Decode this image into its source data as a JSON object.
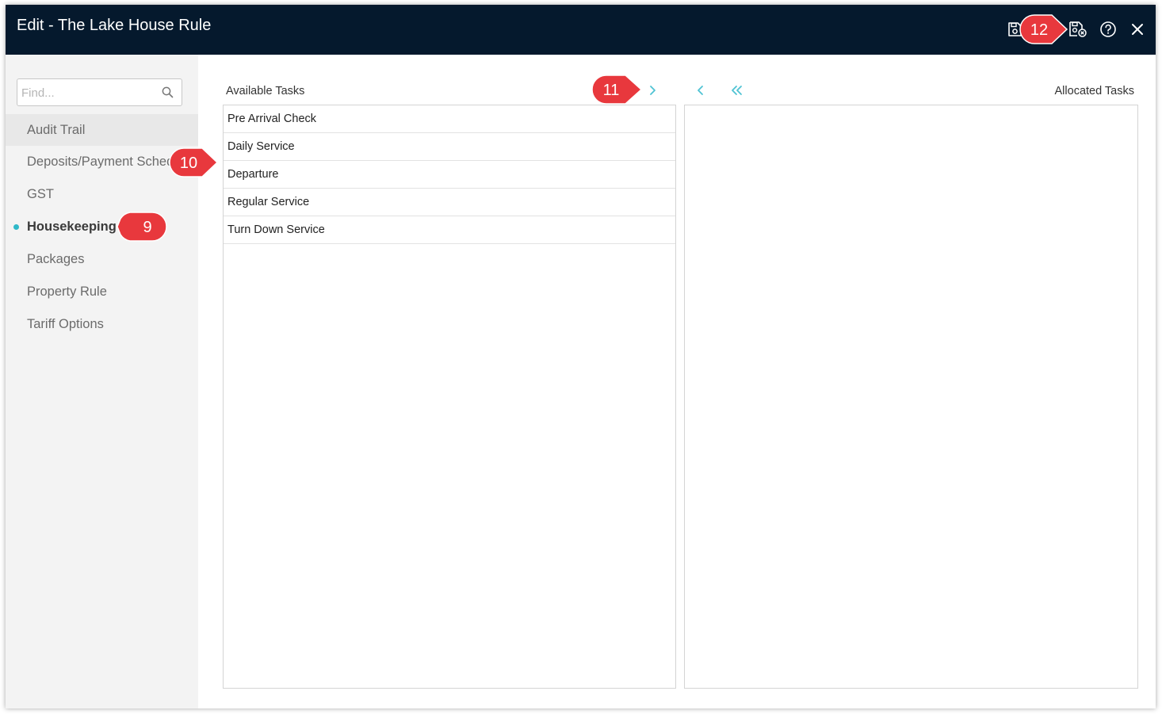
{
  "window": {
    "title": "Edit - The Lake House Rule",
    "accent_color": "#05192d",
    "toolbar_icons": [
      "save-icon",
      "save-close-icon",
      "help-icon",
      "close-icon"
    ]
  },
  "sidebar": {
    "find_placeholder": "Find...",
    "items": [
      {
        "label": "Audit Trail"
      },
      {
        "label": "Deposits/Payment Schedule"
      },
      {
        "label": "GST"
      },
      {
        "label": "Housekeeping",
        "active": true
      },
      {
        "label": "Packages"
      },
      {
        "label": "Property Rule"
      },
      {
        "label": "Tariff Options"
      }
    ]
  },
  "main": {
    "available_label": "Available Tasks",
    "allocated_label": "Allocated Tasks",
    "available_tasks": [
      "Pre Arrival Check",
      "Daily Service",
      "Departure",
      "Regular Service",
      "Turn Down Service"
    ],
    "allocated_tasks": [],
    "arrow_color": "#4fc3d3"
  },
  "callouts": {
    "c9": "9",
    "c10": "10",
    "c11": "11",
    "c12": "12",
    "color": "#e8383d"
  }
}
